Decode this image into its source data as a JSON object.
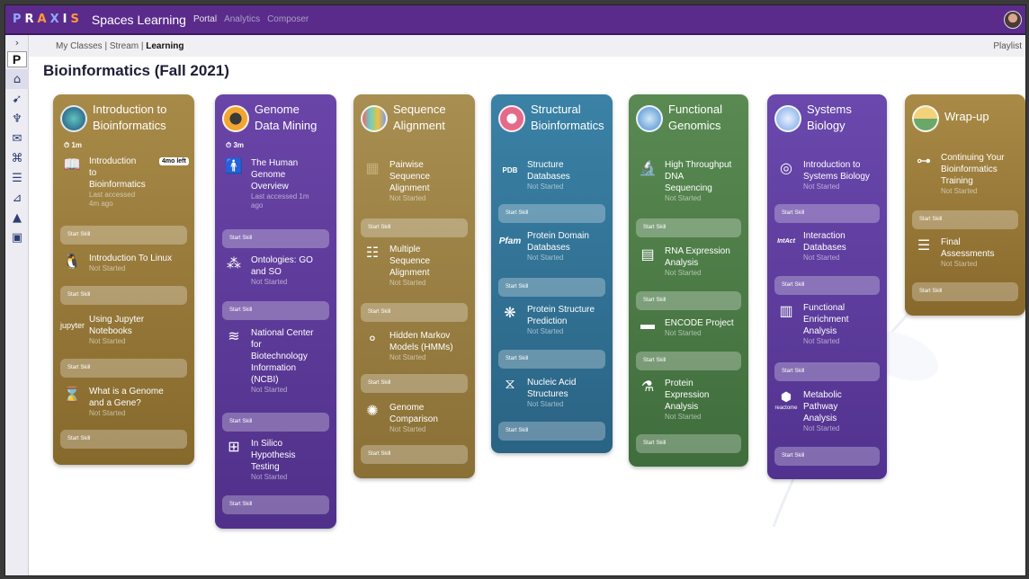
{
  "topbar": {
    "brand": "PRAXIS",
    "app_title": "Spaces Learning",
    "links": [
      "Portal",
      "Analytics",
      "Composer"
    ]
  },
  "subnav": {
    "crumbs": [
      "My Classes",
      "Stream",
      "Learning"
    ],
    "right": "Playlist"
  },
  "page_title": "Bioinformatics (Fall 2021)",
  "sidebar_letter": "P",
  "start_label": "Start Skill",
  "colors": {
    "topbar": "#5b2b8c",
    "intro": "#9a7a3a",
    "genome": "#5e3a9a",
    "seq": "#9a8040",
    "struct": "#2f6f93",
    "func": "#4b7a46",
    "sys": "#5d3a9e",
    "wrap": "#9b7f3c"
  },
  "cards": [
    {
      "title_line1": "Introduction to",
      "title_line2": "Bioinformatics",
      "duration": "1m",
      "items": [
        {
          "line1": "Introduction",
          "line2": "to",
          "line3": "Bioinformatics",
          "status": "Last accessed",
          "status2": "4m ago",
          "tag": "4mo left"
        },
        {
          "line1": "Introduction To Linux",
          "status": "Not Started"
        },
        {
          "line1": "Using Jupyter",
          "line2": "Notebooks",
          "status": "Not Started"
        },
        {
          "line1": "What is a Genome",
          "line2": "and a Gene?",
          "status": "Not Started"
        }
      ]
    },
    {
      "title_line1": "Genome",
      "title_line2": "Data Mining",
      "duration": "3m",
      "items": [
        {
          "line1": "The Human",
          "line2": "Genome",
          "line3": "Overview",
          "status": "Last accessed 1m",
          "status2": "ago"
        },
        {
          "line1": "Ontologies: GO",
          "line2": "and SO",
          "status": "Not Started"
        },
        {
          "line1": "National Center",
          "line2": "for",
          "line3": "Biotechnology",
          "line4": "Information",
          "line5": "(NCBI)",
          "status": "Not Started"
        },
        {
          "line1": "In Silico",
          "line2": "Hypothesis",
          "line3": "Testing",
          "status": "Not Started"
        }
      ]
    },
    {
      "title_line1": "Sequence",
      "title_line2": "Alignment",
      "items": [
        {
          "line1": "Pairwise",
          "line2": "Sequence",
          "line3": "Alignment",
          "status": "Not Started"
        },
        {
          "line1": "Multiple",
          "line2": "Sequence",
          "line3": "Alignment",
          "status": "Not Started"
        },
        {
          "line1": "Hidden Markov",
          "line2": "Models (HMMs)",
          "status": "Not Started"
        },
        {
          "line1": "Genome",
          "line2": "Comparison",
          "status": "Not Started"
        }
      ]
    },
    {
      "title_line1": "Structural",
      "title_line2": "Bioinformatics",
      "items": [
        {
          "line1": "Structure",
          "line2": "Databases",
          "status": "Not Started",
          "icon_text": "PDB"
        },
        {
          "line1": "Protein Domain",
          "line2": "Databases",
          "status": "Not Started",
          "icon_text": "Pfam"
        },
        {
          "line1": "Protein Structure",
          "line2": "Prediction",
          "status": "Not Started"
        },
        {
          "line1": "Nucleic Acid",
          "line2": "Structures",
          "status": "Not Started"
        }
      ]
    },
    {
      "title_line1": "Functional",
      "title_line2": "Genomics",
      "items": [
        {
          "line1": "High Throughput",
          "line2": "DNA",
          "line3": "Sequencing",
          "status": "Not Started"
        },
        {
          "line1": "RNA Expression",
          "line2": "Analysis",
          "status": "Not Started"
        },
        {
          "line1": "ENCODE Project",
          "status": "Not Started"
        },
        {
          "line1": "Protein",
          "line2": "Expression",
          "line3": "Analysis",
          "status": "Not Started"
        }
      ]
    },
    {
      "title_line1": "Systems",
      "title_line2": "Biology",
      "items": [
        {
          "line1": "Introduction to",
          "line2": "Systems Biology",
          "status": "Not Started"
        },
        {
          "line1": "Interaction",
          "line2": "Databases",
          "status": "Not Started",
          "icon_text": "IntAct"
        },
        {
          "line1": "Functional",
          "line2": "Enrichment",
          "line3": "Analysis",
          "status": "Not Started"
        },
        {
          "line1": "Metabolic",
          "line2": "Pathway",
          "line3": "Analysis",
          "status": "Not Started",
          "icon_text": "reactome"
        }
      ]
    },
    {
      "title_line1": "Wrap-up",
      "items": [
        {
          "line1": "Continuing Your",
          "line2": "Bioinformatics",
          "line3": "Training",
          "status": "Not Started"
        },
        {
          "line1": "Final",
          "line2": "Assessments",
          "status": "Not Started"
        }
      ]
    }
  ]
}
